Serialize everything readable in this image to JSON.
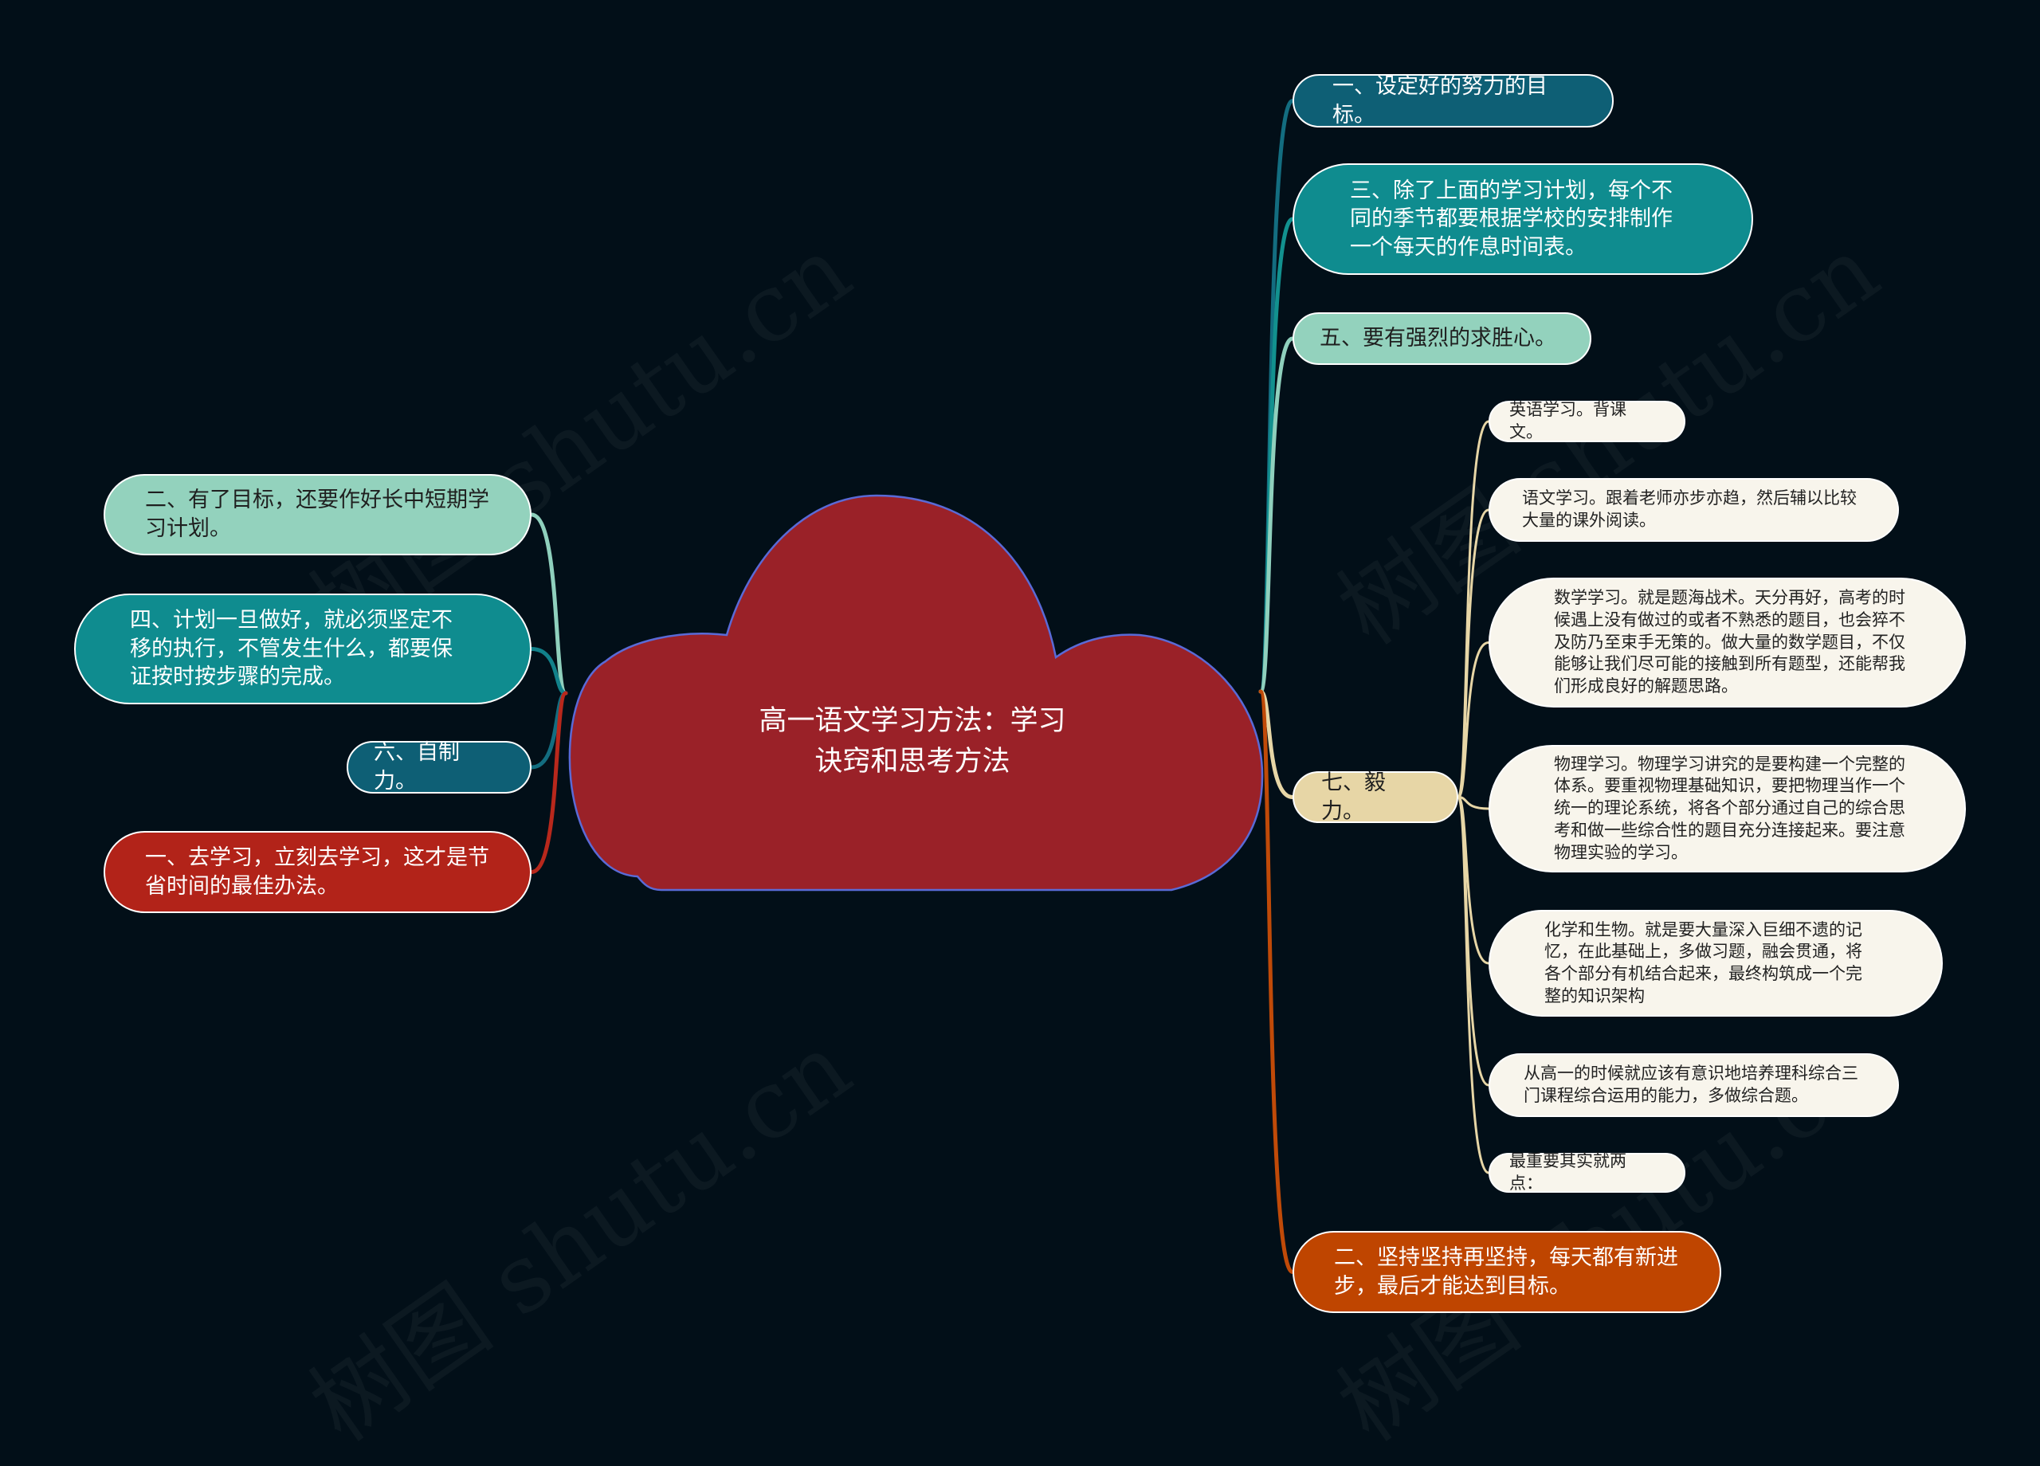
{
  "root": {
    "title": "高一语文学习方法：学习诀窍和思考方法",
    "title_line1": "高一语文学习方法：学习",
    "title_line2": "诀窍和思考方法",
    "shape": "cloud",
    "fill": "#9a2128",
    "stroke": "#5a6ad6"
  },
  "watermark": "树图 shutu.cn",
  "right_branches": [
    {
      "id": "r1",
      "text": "一、设定好的努力的目标。",
      "color": "#0e5f75",
      "line_color": "#136d80"
    },
    {
      "id": "r2",
      "text": "三、除了上面的学习计划，每个不同的季节都要根据学校的安排制作一个每天的作息时间表。",
      "color": "#0f8c8f",
      "line_color": "#12918f"
    },
    {
      "id": "r3",
      "text": "五、要有强烈的求胜心。",
      "color": "#93d2bd",
      "line_color": "#8fd0bd"
    },
    {
      "id": "r4",
      "text": "七、毅力。",
      "color": "#e7d6a6",
      "line_color": "#e7d6a6",
      "children": [
        {
          "text": "英语学习。背课文。"
        },
        {
          "text": "语文学习。跟着老师亦步亦趋，然后辅以比较大量的课外阅读。"
        },
        {
          "text": "数学学习。就是题海战术。天分再好，高考的时候遇上没有做过的或者不熟悉的题目，也会猝不及防乃至束手无策的。做大量的数学题目，不仅能够让我们尽可能的接触到所有题型，还能帮我们形成良好的解题思路。"
        },
        {
          "text": "物理学习。物理学习讲究的是要构建一个完整的体系。要重视物理基础知识，要把物理当作一个统一的理论系统，将各个部分通过自己的综合思考和做一些综合性的题目充分连接起来。要注意物理实验的学习。"
        },
        {
          "text": "化学和生物。就是要大量深入巨细不遗的记忆，在此基础上，多做习题，融会贯通，将各个部分有机结合起来，最终构筑成一个完整的知识架构"
        },
        {
          "text": "从高一的时候就应该有意识地培养理科综合三门课程综合运用的能力，多做综合题。"
        },
        {
          "text": "最重要其实就两点："
        }
      ]
    },
    {
      "id": "r5",
      "text": "二、坚持坚持再坚持，每天都有新进步，最后才能达到目标。",
      "color": "#bf4500",
      "line_color": "#c04a08"
    }
  ],
  "left_branches": [
    {
      "id": "l1",
      "text": "二、有了目标，还要作好长中短期学习计划。",
      "color": "#93d2bd",
      "line_color": "#8fd0bd"
    },
    {
      "id": "l2",
      "text": "四、计划一旦做好，就必须坚定不移的执行，不管发生什么，都要保证按时按步骤的完成。",
      "color": "#0f8c8f",
      "line_color": "#12818a"
    },
    {
      "id": "l3",
      "text": "六、自制力。",
      "color": "#0e5f75",
      "line_color": "#136d80"
    },
    {
      "id": "l4",
      "text": "一、去学习，立刻去学习，这才是节省时间的最佳办法。",
      "color": "#b22319",
      "line_color": "#b8281c"
    }
  ],
  "leaf_color": "#f8f5ec"
}
